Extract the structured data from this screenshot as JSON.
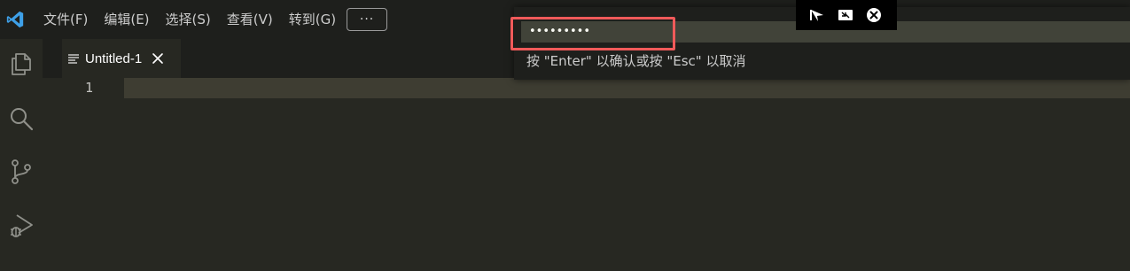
{
  "titlebar": {
    "logo": "vscode-logo-icon",
    "menu": [
      {
        "label": "文件(F)"
      },
      {
        "label": "编辑(E)"
      },
      {
        "label": "选择(S)"
      },
      {
        "label": "查看(V)"
      },
      {
        "label": "转到(G)"
      }
    ],
    "more_label": "···"
  },
  "activity_bar": {
    "icons": [
      "files-icon",
      "search-icon",
      "source-control-icon",
      "run-debug-icon"
    ]
  },
  "tabs": [
    {
      "label": "Untitled-1",
      "icon": "file-icon",
      "close_icon": "close-icon"
    }
  ],
  "editor": {
    "line_numbers": [
      "1"
    ]
  },
  "quick_input": {
    "masked_value": "•••••••••",
    "message": "按 \"Enter\" 以确认或按 \"Esc\" 以取消"
  },
  "overlay_toolbar": {
    "icons": [
      "send-icon",
      "collapse-icon",
      "close-circle-icon"
    ]
  },
  "colors": {
    "editor_background": "#272822",
    "titlebar_background": "#1e1f1c",
    "current_line": "#3e3d32",
    "highlight_box": "#f05a5a",
    "vscode_blue": "#3ea0e8"
  }
}
